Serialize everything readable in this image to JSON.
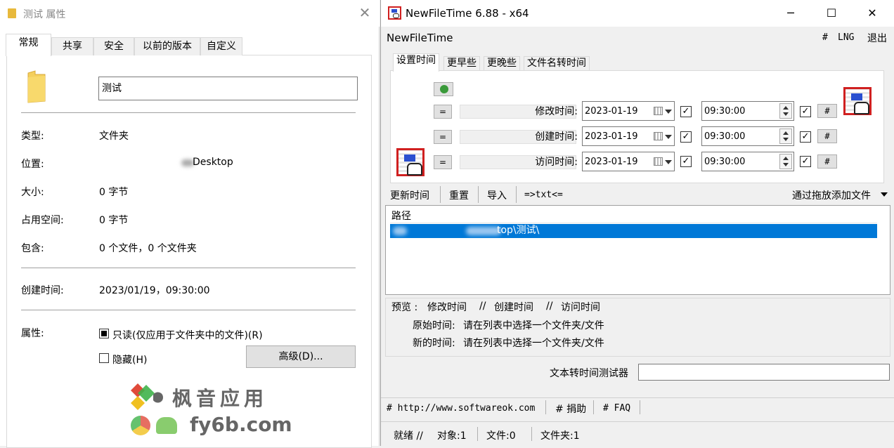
{
  "properties": {
    "title": "测试 属性",
    "tabs": [
      "常规",
      "共享",
      "安全",
      "以前的版本",
      "自定义"
    ],
    "folder_name": "测试",
    "fields": {
      "type_label": "类型:",
      "type_value": "文件夹",
      "location_label": "位置:",
      "location_value": "Desktop",
      "size_label": "大小:",
      "size_value": "0 字节",
      "disk_label": "占用空间:",
      "disk_value": "0 字节",
      "contains_label": "包含:",
      "contains_value": "0 个文件，0 个文件夹",
      "created_label": "创建时间:",
      "created_value": "2023/01/19，09:30:00",
      "attr_label": "属性:"
    },
    "readonly_label": "只读(仅应用于文件夹中的文件)(R)",
    "hidden_label": "隐藏(H)",
    "advanced_button": "高级(D)..."
  },
  "newfiletime": {
    "window_title": "NewFileTime 6.88 - x64",
    "app_label": "NewFileTime",
    "menu": {
      "hash": "#",
      "lng": "LNG",
      "exit": "退出"
    },
    "tabs": [
      "设置时间",
      "更早些",
      "更晚些",
      "文件名转时间"
    ],
    "rows": [
      {
        "label": "修改时间:",
        "date": "2023-01-19",
        "time": "09:30:00"
      },
      {
        "label": "创建时间:",
        "date": "2023-01-19",
        "time": "09:30:00"
      },
      {
        "label": "访问时间:",
        "date": "2023-01-19",
        "time": "09:30:00"
      }
    ],
    "eq_label": "=",
    "hash_label": "#",
    "check_mark": "✓",
    "toolbar": {
      "update": "更新时间",
      "reset": "重置",
      "import": "导入",
      "txt": "=>txt<=",
      "drag": "通过拖放添加文件"
    },
    "list": {
      "header": "路径",
      "row": "top\\测试\\"
    },
    "preview": {
      "title": "预览 :",
      "mod": "修改时间",
      "sep": "//",
      "create": "创建时间",
      "access": "访问时间",
      "orig_label": "原始时间:",
      "orig_value": "请在列表中选择一个文件夹/文件",
      "new_label": "新的时间:",
      "new_value": "请在列表中选择一个文件夹/文件"
    },
    "tester_label": "文本转时间测试器",
    "links": {
      "site": "# http://www.softwareok.com",
      "donate": "# 捐助",
      "faq": "# FAQ"
    },
    "status": {
      "ready": "就绪 //",
      "objects": "对象:1",
      "files": "文件:0",
      "folders": "文件夹:1"
    }
  },
  "watermark": {
    "cn": "枫音应用",
    "en": "fy6b.com"
  }
}
